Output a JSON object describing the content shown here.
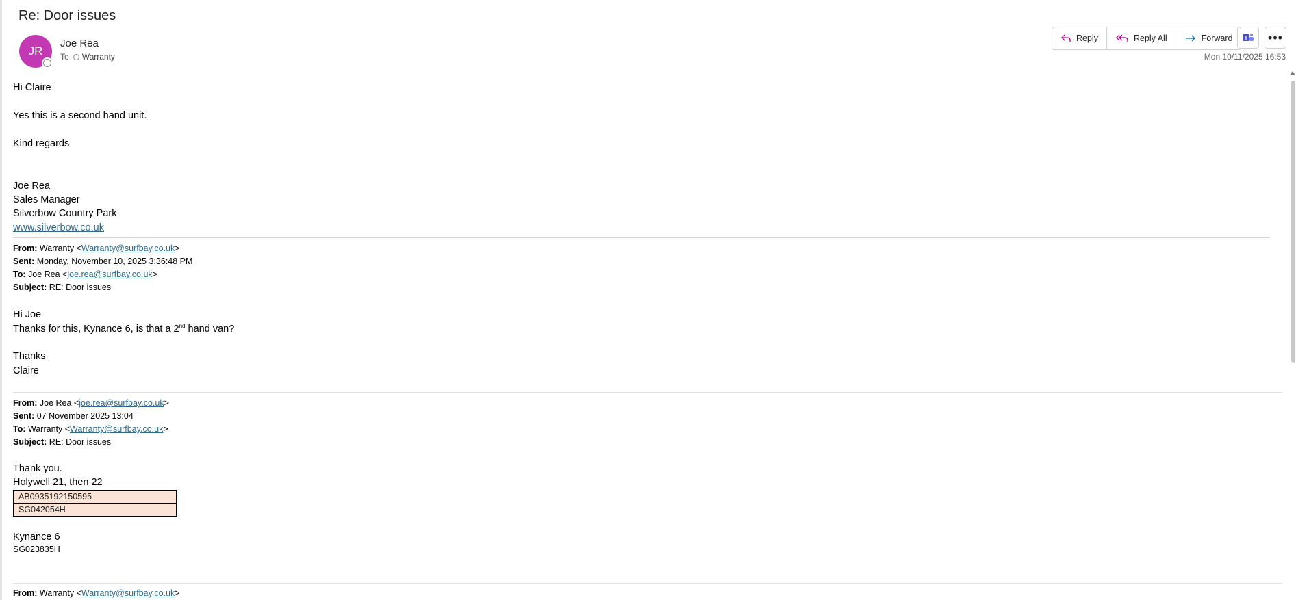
{
  "subject": "Re: Door issues",
  "sender": {
    "initials": "JR",
    "name": "Joe Rea",
    "avatar_color": "#c239b3"
  },
  "to_label": "To",
  "recipient": "Warranty",
  "actions": {
    "reply": "Reply",
    "reply_all": "Reply All",
    "forward": "Forward"
  },
  "timestamp": "Mon 10/11/2025 16:53",
  "message": {
    "greeting": "Hi Claire",
    "line1": "Yes this is a second hand unit.",
    "closing": "Kind regards",
    "signature": {
      "name": "Joe Rea",
      "title": "Sales Manager",
      "company": "Silverbow Country Park",
      "website": "www.silverbow.co.uk"
    }
  },
  "quoted1": {
    "from_label": "From:",
    "from_name": "Warranty <",
    "from_email": "Warranty@surfbay.co.uk",
    "from_end": ">",
    "sent_label": "Sent:",
    "sent": "Monday, November 10, 2025 3:36:48 PM",
    "to_label": "To:",
    "to_name": "Joe Rea <",
    "to_email": "joe.rea@surfbay.co.uk",
    "to_end": ">",
    "subject_label": "Subject:",
    "subject": "RE: Door issues",
    "greeting": "Hi Joe",
    "line_pre": "Thanks for this, Kynance 6, is that a 2",
    "line_sup": "nd",
    "line_post": " hand van?",
    "closing": "Thanks",
    "signoff": "Claire"
  },
  "quoted2": {
    "from_label": "From:",
    "from_name": "Joe Rea <",
    "from_email": "joe.rea@surfbay.co.uk",
    "from_end": ">",
    "sent_label": "Sent:",
    "sent": "07 November 2025 13:04",
    "to_label": "To:",
    "to_name": "Warranty <",
    "to_email": "Warranty@surfbay.co.uk",
    "to_end": ">",
    "subject_label": "Subject:",
    "subject": "RE: Door issues",
    "line1": "Thank you.",
    "line2": "Holywell 21, then 22",
    "codes": [
      "AB0935192150595",
      "SG042054H"
    ],
    "unit": "Kynance 6",
    "unit_code": "SG023835H"
  },
  "quoted3": {
    "from_label": "From:",
    "from_name": "Warranty <",
    "from_email": "Warranty@surfbay.co.uk",
    "from_end": ">"
  },
  "colors": {
    "link": "#2f6a8a",
    "table_fill": "#fbe3d6",
    "teams_purple": "#4b53bc",
    "reply_icon": "#b4009e",
    "forward_icon": "#0f6cbd"
  }
}
